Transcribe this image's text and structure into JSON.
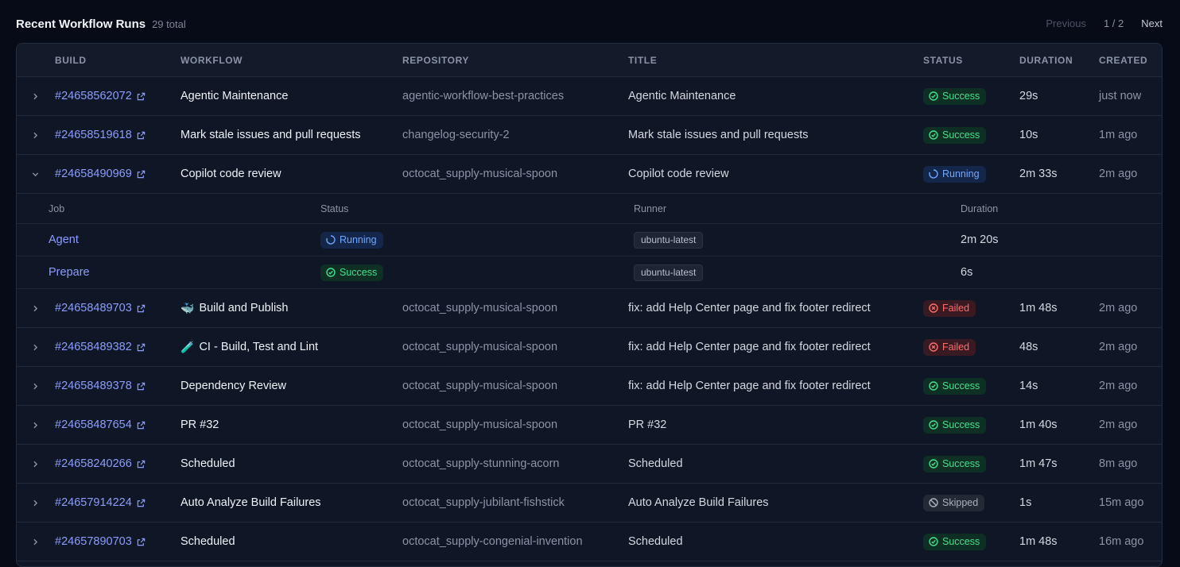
{
  "header": {
    "title": "Recent Workflow Runs",
    "total": "29 total",
    "pager": {
      "previous": "Previous",
      "pages": "1 / 2",
      "next": "Next"
    }
  },
  "columns": {
    "build": "BUILD",
    "workflow": "WORKFLOW",
    "repository": "REPOSITORY",
    "title": "TITLE",
    "status": "STATUS",
    "duration": "DURATION",
    "created": "CREATED"
  },
  "runs": [
    {
      "build": "#24658562072",
      "workflow": "Agentic Maintenance",
      "workflow_icon": "",
      "repository": "agentic-workflow-best-practices",
      "title": "Agentic Maintenance",
      "status": "Success",
      "duration": "29s",
      "created": "just now",
      "expanded": false
    },
    {
      "build": "#24658519618",
      "workflow": "Mark stale issues and pull requests",
      "workflow_icon": "",
      "repository": "changelog-security-2",
      "title": "Mark stale issues and pull requests",
      "status": "Success",
      "duration": "10s",
      "created": "1m ago",
      "expanded": false
    },
    {
      "build": "#24658490969",
      "workflow": "Copilot code review",
      "workflow_icon": "",
      "repository": "octocat_supply-musical-spoon",
      "title": "Copilot code review",
      "status": "Running",
      "duration": "2m 33s",
      "created": "2m ago",
      "expanded": true
    },
    {
      "build": "#24658489703",
      "workflow": "Build and Publish",
      "workflow_icon": "🐳",
      "repository": "octocat_supply-musical-spoon",
      "title": "fix: add Help Center page and fix footer redirect",
      "status": "Failed",
      "duration": "1m 48s",
      "created": "2m ago",
      "expanded": false
    },
    {
      "build": "#24658489382",
      "workflow": "CI - Build, Test and Lint",
      "workflow_icon": "🧪",
      "repository": "octocat_supply-musical-spoon",
      "title": "fix: add Help Center page and fix footer redirect",
      "status": "Failed",
      "duration": "48s",
      "created": "2m ago",
      "expanded": false
    },
    {
      "build": "#24658489378",
      "workflow": "Dependency Review",
      "workflow_icon": "",
      "repository": "octocat_supply-musical-spoon",
      "title": "fix: add Help Center page and fix footer redirect",
      "status": "Success",
      "duration": "14s",
      "created": "2m ago",
      "expanded": false
    },
    {
      "build": "#24658487654",
      "workflow": "PR #32",
      "workflow_icon": "",
      "repository": "octocat_supply-musical-spoon",
      "title": "PR #32",
      "status": "Success",
      "duration": "1m 40s",
      "created": "2m ago",
      "expanded": false
    },
    {
      "build": "#24658240266",
      "workflow": "Scheduled",
      "workflow_icon": "",
      "repository": "octocat_supply-stunning-acorn",
      "title": "Scheduled",
      "status": "Success",
      "duration": "1m 47s",
      "created": "8m ago",
      "expanded": false
    },
    {
      "build": "#24657914224",
      "workflow": "Auto Analyze Build Failures",
      "workflow_icon": "",
      "repository": "octocat_supply-jubilant-fishstick",
      "title": "Auto Analyze Build Failures",
      "status": "Skipped",
      "duration": "1s",
      "created": "15m ago",
      "expanded": false
    },
    {
      "build": "#24657890703",
      "workflow": "Scheduled",
      "workflow_icon": "",
      "repository": "octocat_supply-congenial-invention",
      "title": "Scheduled",
      "status": "Success",
      "duration": "1m 48s",
      "created": "16m ago",
      "expanded": false
    }
  ],
  "jobs": {
    "columns": {
      "job": "Job",
      "status": "Status",
      "runner": "Runner",
      "duration": "Duration"
    },
    "rows": [
      {
        "job": "Agent",
        "status": "Running",
        "runner": "ubuntu-latest",
        "duration": "2m 20s"
      },
      {
        "job": "Prepare",
        "status": "Success",
        "runner": "ubuntu-latest",
        "duration": "6s"
      }
    ]
  },
  "colors": {
    "background": "#060b17",
    "panel": "#0f1726",
    "link": "#8c9cff",
    "success": "#3ee08a",
    "running": "#6ea8ff",
    "failed": "#ff6b6b",
    "skipped": "#a9b0bd"
  }
}
